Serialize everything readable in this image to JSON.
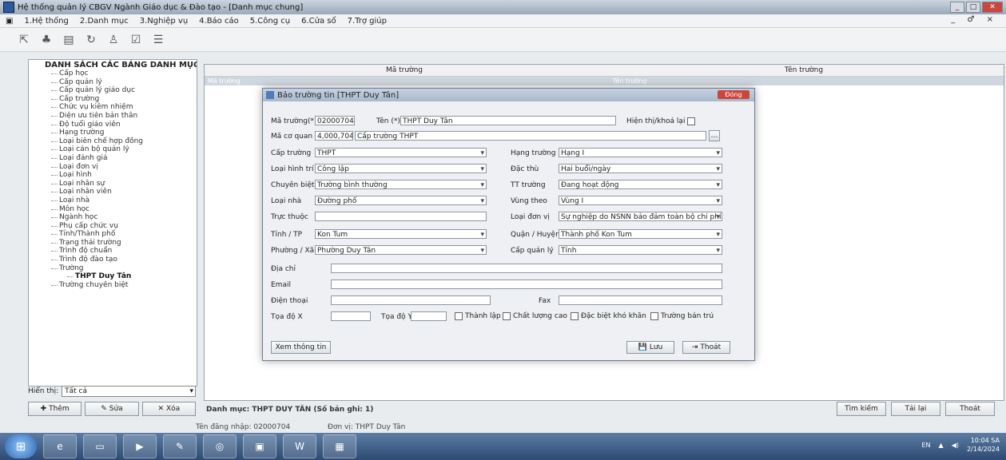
{
  "window": {
    "title": "Hệ thống quản lý CBGV Ngành Giáo dục & Đào tạo - [Danh mục chung]",
    "controls": [
      "_",
      "□",
      "✕"
    ]
  },
  "menu": {
    "items": [
      "1.Hệ thống",
      "2.Danh mục",
      "3.Nghiệp vụ",
      "4.Báo cáo",
      "5.Công cụ",
      "6.Cửa sổ",
      "7.Trợ giúp"
    ],
    "window_controls": "_ ♂ ×"
  },
  "toolbar": {
    "icons": [
      "exit-icon",
      "tree-icon",
      "save-icon",
      "refresh-icon",
      "users-icon",
      "check-icon",
      "settings-icon"
    ]
  },
  "tree": {
    "root": "DANH SÁCH CÁC BẢNG DANH MỤC",
    "items": [
      "Cấp học",
      "Cấp quản lý",
      "Cấp quản lý giáo dục",
      "Cấp trường",
      "Chức vụ kiêm nhiệm",
      "Diện ưu tiên bản thân",
      "Độ tuổi giáo viên",
      "Hạng trường",
      "Loại biên chế hợp đồng",
      "Loại cán bộ quản lý",
      "Loại đánh giá",
      "Loại đơn vị",
      "Loại hình",
      "Loại nhân sự",
      "Loại nhân viên",
      "Loại nhà",
      "Môn học",
      "Ngành học",
      "Phụ cấp chức vụ",
      "Tỉnh/Thành phố",
      "Trạng thái trường",
      "Trình độ chuẩn",
      "Trình độ đào tạo",
      "Trường"
    ],
    "sub_item": "THPT Duy Tân",
    "last_item": "Trường chuyên biệt"
  },
  "filter": {
    "label": "Hiển thị:",
    "value": "Tất cả"
  },
  "left_buttons": {
    "add": "Thêm",
    "edit": "Sửa",
    "delete": "Xóa"
  },
  "grid": {
    "headers": [
      "Mã trường",
      "Tên trường"
    ],
    "row": [
      "Mã trường",
      "Tên trường"
    ]
  },
  "status_info": "Danh mục: THPT DUY TÂN (Số bản ghi: 1)",
  "right_buttons": {
    "search": "Tìm kiếm",
    "refresh": "Tải lại",
    "close": "Thoát"
  },
  "login": {
    "user": "Tên đăng nhập: 02000704",
    "unit": "Đơn vị: THPT Duy Tân"
  },
  "dialog": {
    "title": "Bảo trường tin [THPT Duy Tân]",
    "close_label": "Đóng",
    "fields": {
      "ma_truong_label": "Mã trường(*)",
      "ma_truong_value": "02000704",
      "ten_label": "Tên (*)",
      "ten_value": "THPT Duy Tân",
      "hien_thi_label": "Hiện thị/khoá lại",
      "mang_cq_label": "Mã cơ quan (*)",
      "mang_cq_code": "4,000,704",
      "mang_cq_value": "Cấp trường THPT",
      "cap_truong_label": "Cấp trường",
      "cap_truong_value": "THPT",
      "hang_truong_label": "Hạng trường",
      "hang_truong_value": "Hạng I",
      "loai_hinh_label": "Loại hình trí",
      "loai_hinh_value": "Công lập",
      "dac_thu_label": "Đặc thù",
      "dac_thu_value": "Hai buổi/ngày",
      "chuyen_biet_label": "Chuyên biệt",
      "chuyen_biet_value": "Trường bình thường",
      "tt_truong_label": "TT trường",
      "tt_truong_value": "Đang hoạt động",
      "loai_nha_label": "Loại nhà",
      "loai_nha_value": "Đường phố",
      "vung_label": "Vùng theo",
      "vung_value": "Vùng I",
      "truc_thuoc_label": "Trực thuộc",
      "loai_dv_label": "Loại đơn vị",
      "loai_dv_value": "Sự nghiệp do NSNN bảo đảm toàn bộ chi phí",
      "tinh_label": "Tỉnh / TP",
      "tinh_value": "Kon Tum",
      "quan_label": "Quận / Huyện",
      "quan_value": "Thành phố Kon Tum",
      "phuong_label": "Phường / Xã",
      "phuong_value": "Phường Duy Tân",
      "cap_ql_label": "Cấp quản lý",
      "cap_ql_value": "Tỉnh",
      "dia_chi_label": "Địa chỉ",
      "email_label": "Email",
      "dien_thoai_label": "Điện thoại",
      "fax_label": "Fax",
      "toa_do_x_label": "Tọa độ X",
      "toa_do_y_label": "Tọa độ Y",
      "chk1": "Thành lập",
      "chk2": "Chất lượng cao",
      "chk3": "Đặc biệt khó khăn",
      "chk4": "Trường bán trú"
    },
    "buttons": {
      "more": "Xem thông tin",
      "save": "Lưu",
      "exit": "Thoát"
    }
  },
  "taskbar": {
    "apps": [
      "IE",
      "Explorer",
      "Media",
      "Paint",
      "Chrome",
      "Folder",
      "Word",
      "App"
    ],
    "time": "10:04 SA",
    "date": "2/14/2024",
    "lang": "EN"
  }
}
